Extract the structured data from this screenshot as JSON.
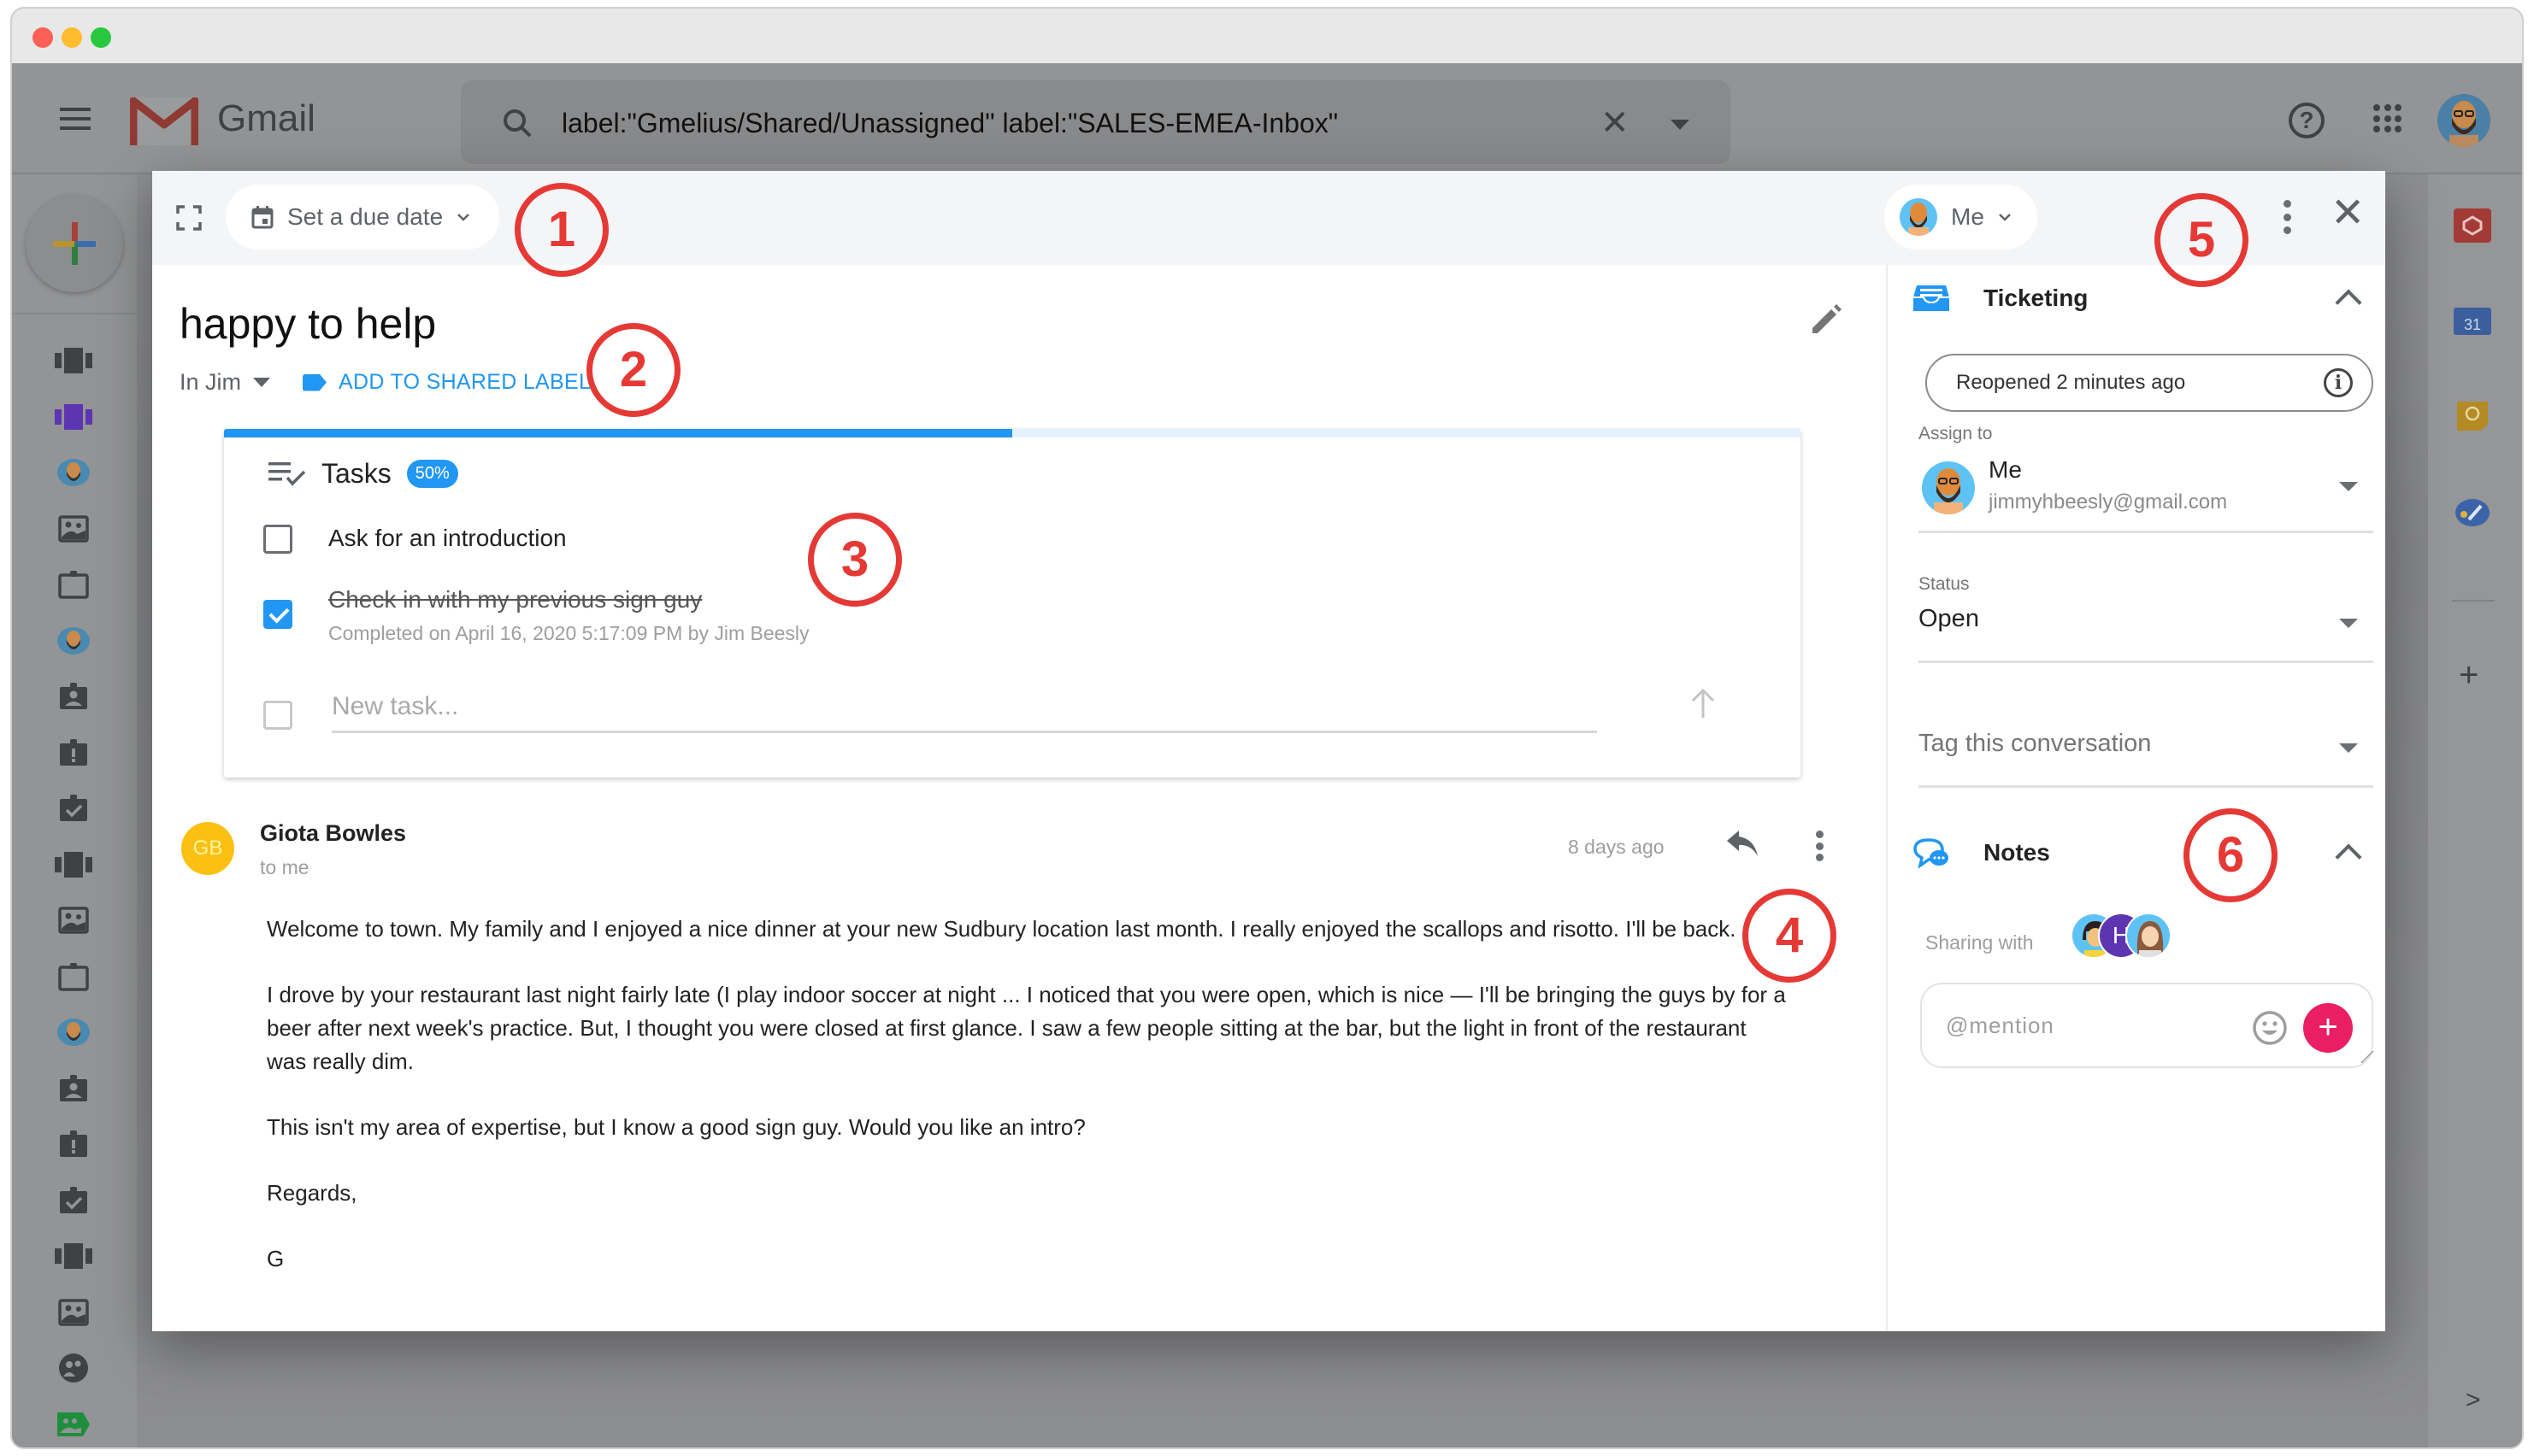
{
  "window": {
    "controls": [
      "close",
      "minimize",
      "zoom"
    ]
  },
  "gmail_header": {
    "app_name": "Gmail",
    "search": {
      "value": "label:\"Gmelius/Shared/Unassigned\" label:\"SALES-EMEA-Inbox\"",
      "clear_icon": "close-icon",
      "options_icon": "dropdown-icon"
    },
    "help_icon": "help-icon",
    "apps_icon": "apps-grid-icon",
    "account_avatar": "bearded-man-avatar"
  },
  "left_rail": {
    "compose_icon": "compose-plus-icon",
    "items": [
      {
        "icon": "carousel-icon",
        "color": "#3f4244"
      },
      {
        "icon": "carousel-icon",
        "color": "#5e35b1"
      },
      {
        "icon": "avatar-icon",
        "color": "#4a8ab0"
      },
      {
        "icon": "image-board-icon",
        "color": "#3f4244"
      },
      {
        "icon": "clipboard-icon",
        "color": "#3f4244"
      },
      {
        "icon": "avatar-icon",
        "color": "#4a8ab0"
      },
      {
        "icon": "clipboard-account-icon",
        "color": "#3f4244"
      },
      {
        "icon": "clipboard-alert-icon",
        "color": "#3f4244"
      },
      {
        "icon": "clipboard-check-icon",
        "color": "#3f4244"
      },
      {
        "icon": "carousel-icon",
        "color": "#3f4244"
      },
      {
        "icon": "image-board-icon",
        "color": "#3f4244"
      },
      {
        "icon": "clipboard-icon",
        "color": "#3f4244",
        "active": true
      },
      {
        "icon": "avatar-icon",
        "color": "#4a8ab0"
      },
      {
        "icon": "clipboard-account-icon",
        "color": "#3f4244"
      },
      {
        "icon": "clipboard-alert-icon",
        "color": "#3f4244"
      },
      {
        "icon": "clipboard-check-icon",
        "color": "#3f4244"
      },
      {
        "icon": "carousel-icon",
        "color": "#3f4244",
        "active": true
      },
      {
        "icon": "image-board-icon",
        "color": "#3f4244"
      },
      {
        "icon": "group-icon",
        "color": "#3f4244"
      },
      {
        "icon": "label-board-icon",
        "color": "#1e8e3e"
      }
    ]
  },
  "right_rail": {
    "items": [
      "gmelius-icon",
      "calendar-icon",
      "keep-icon",
      "tasks-icon"
    ],
    "calendar_day": "31",
    "add_icon": "plus-icon",
    "expand_icon": "chevron-right-icon"
  },
  "modal": {
    "toolbar": {
      "expand_icon": "fullscreen-icon",
      "due_date_label": "Set a due date",
      "assignee_label": "Me",
      "more_icon": "more-vert-icon",
      "close_icon": "close-icon"
    },
    "conversation": {
      "subject": "happy to help",
      "folder_prefix": "In Jim",
      "add_shared_label": "ADD TO SHARED LABEL",
      "tasks": {
        "title": "Tasks",
        "progress_percent": 50,
        "badge": "50%",
        "items": [
          {
            "text": "Ask for an introduction",
            "done": false,
            "meta": ""
          },
          {
            "text": "Check in with my previous sign guy",
            "done": true,
            "meta": "Completed on April 16, 2020 5:17:09 PM by Jim Beesly"
          }
        ],
        "new_task_placeholder": "New task..."
      },
      "message": {
        "sender_initials": "GB",
        "sender_name": "Giota Bowles",
        "recipient": "to me",
        "time": "8 days ago",
        "paragraphs": [
          "Welcome to town. My family and I enjoyed a nice dinner at your new Sudbury location last month. I really enjoyed the scallops and risotto. I'll be back.",
          "I drove by your restaurant last night fairly late (I play indoor soccer at night ... I noticed that you were open, which is nice — I'll be bringing the guys by for a beer after next week's practice. But, I thought you were closed at first glance. I saw a few people sitting at the bar, but the light in front of the restaurant was really dim.",
          "This isn't my area of expertise, but I know a good sign guy. Would you like an intro?",
          "Regards,",
          "G"
        ]
      }
    },
    "sidebar": {
      "ticketing": {
        "title": "Ticketing",
        "status_pill": "Reopened 2 minutes ago",
        "assign_label": "Assign to",
        "assignee_name": "Me",
        "assignee_email": "jimmyhbeesly@gmail.com",
        "status_label": "Status",
        "status_value": "Open",
        "tag_placeholder": "Tag this conversation"
      },
      "notes": {
        "title": "Notes",
        "sharing_label": "Sharing with",
        "sharing_avatars": [
          {
            "type": "illustration",
            "desc": "woman-glasses-avatar"
          },
          {
            "type": "initial",
            "initial": "H",
            "color": "#5e35b1"
          },
          {
            "type": "illustration",
            "desc": "woman-long-hair-avatar"
          }
        ],
        "mention_placeholder": "@mention",
        "emoji_icon": "emoji-icon",
        "add_icon": "add-icon"
      }
    }
  },
  "annotations": [
    "1",
    "2",
    "3",
    "4",
    "5",
    "6"
  ],
  "colors": {
    "accent_blue": "#2196f3",
    "annotation_red": "#e53935",
    "add_note_pink": "#e91e63",
    "sender_avatar_yellow": "#fcc012"
  }
}
